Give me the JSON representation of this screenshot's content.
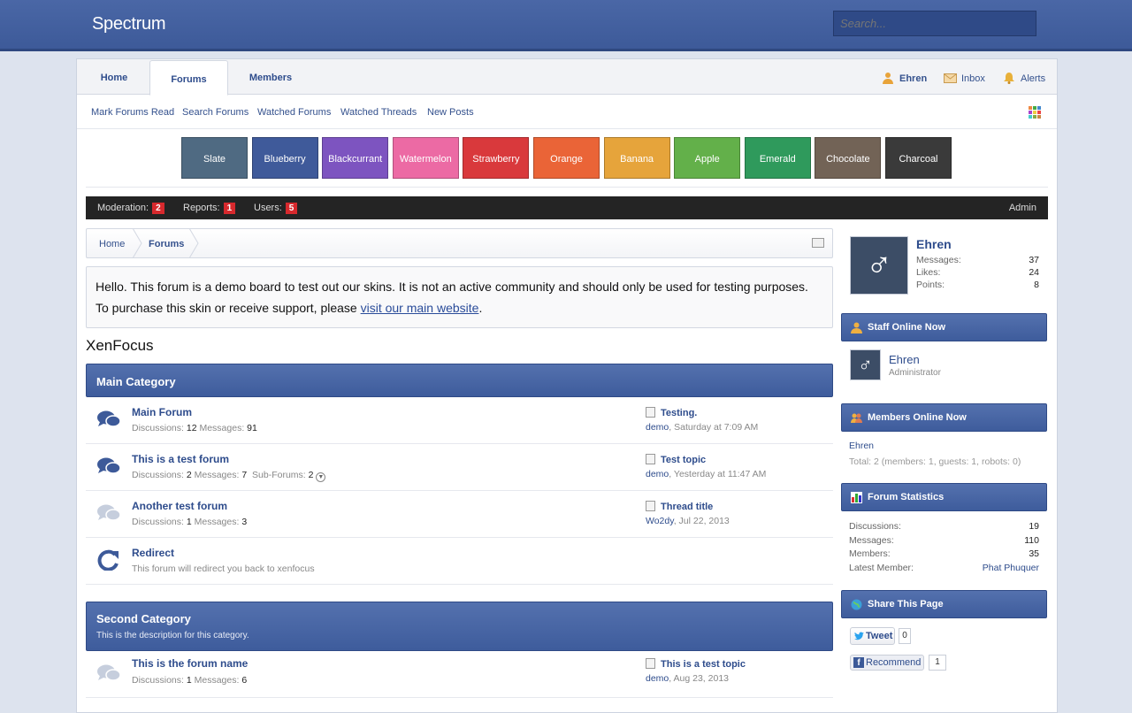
{
  "header": {
    "site_title": "Spectrum",
    "search_placeholder": "Search..."
  },
  "nav": {
    "tabs": [
      {
        "label": "Home"
      },
      {
        "label": "Forums",
        "active": true
      },
      {
        "label": "Members"
      }
    ],
    "user": {
      "name": "Ehren",
      "inbox": "Inbox",
      "alerts": "Alerts"
    }
  },
  "subnav": [
    "Mark Forums Read",
    "Search Forums",
    "Watched Forums",
    "Watched Threads",
    "New Posts"
  ],
  "styles": [
    {
      "label": "Slate",
      "color": "#4f6a82"
    },
    {
      "label": "Blueberry",
      "color": "#3f5a9a"
    },
    {
      "label": "Blackcurrant",
      "color": "#7d54c0"
    },
    {
      "label": "Watermelon",
      "color": "#ec6aa4"
    },
    {
      "label": "Strawberry",
      "color": "#d9393c"
    },
    {
      "label": "Orange",
      "color": "#ea6437"
    },
    {
      "label": "Banana",
      "color": "#e6a43b"
    },
    {
      "label": "Apple",
      "color": "#63b04a"
    },
    {
      "label": "Emerald",
      "color": "#2f9a5c"
    },
    {
      "label": "Chocolate",
      "color": "#726356"
    },
    {
      "label": "Charcoal",
      "color": "#3a3a3a"
    }
  ],
  "adminbar": {
    "moderation": "Moderation:",
    "moderation_count": "2",
    "reports": "Reports:",
    "reports_count": "1",
    "users": "Users:",
    "users_count": "5",
    "admin": "Admin"
  },
  "breadcrumb": [
    "Home",
    "Forums"
  ],
  "notice": {
    "line1": "Hello. This forum is a demo board to test out our skins. It is not an active community and should only be used for testing purposes.",
    "line2_prefix": "To purchase this skin or receive support, please ",
    "link": "visit our main website",
    "line2_suffix": "."
  },
  "section_title": "XenFocus",
  "categories": [
    {
      "title": "Main Category",
      "forums": [
        {
          "name": "Main Forum",
          "stats": {
            "discussions_label": "Discussions:",
            "discussions": "12",
            "messages_label": "Messages:",
            "messages": "91"
          },
          "last_thread": "Testing.",
          "last_user": "demo",
          "last_time": ", Saturday at 7:09 AM",
          "icon": "chat-bubbles-icon"
        },
        {
          "name": "This is a test forum",
          "stats": {
            "discussions_label": "Discussions:",
            "discussions": "2",
            "messages_label": "Messages:",
            "messages": "7",
            "subforums_label": "Sub-Forums:",
            "subforums": "2"
          },
          "last_thread": "Test topic",
          "last_user": "demo",
          "last_time": ", Yesterday at 11:47 AM",
          "icon": "chat-bubbles-icon"
        },
        {
          "name": "Another test forum",
          "stats": {
            "discussions_label": "Discussions:",
            "discussions": "1",
            "messages_label": "Messages:",
            "messages": "3"
          },
          "last_thread": "Thread title",
          "last_user": "Wo2dy",
          "last_time": ", Jul 22, 2013",
          "icon": "chat-bubbles-read-icon"
        },
        {
          "name": "Redirect",
          "description": "This forum will redirect you back to xenfocus",
          "icon": "redirect-icon"
        }
      ]
    },
    {
      "title": "Second Category",
      "description": "This is the description for this category.",
      "forums": [
        {
          "name": "This is the forum name",
          "stats": {
            "discussions_label": "Discussions:",
            "discussions": "1",
            "messages_label": "Messages:",
            "messages": "6"
          },
          "last_thread": "This is a test topic",
          "last_user": "demo",
          "last_time": ", Aug 23, 2013",
          "icon": "chat-bubbles-read-icon"
        }
      ]
    }
  ],
  "sidebar": {
    "profile": {
      "name": "Ehren",
      "messages_label": "Messages:",
      "messages": "37",
      "likes_label": "Likes:",
      "likes": "24",
      "points_label": "Points:",
      "points": "8"
    },
    "staff_online": {
      "title": "Staff Online Now",
      "name": "Ehren",
      "role": "Administrator"
    },
    "members_online": {
      "title": "Members Online Now",
      "member": "Ehren",
      "total": "Total: 2 (members: 1, guests: 1, robots: 0)"
    },
    "forum_stats": {
      "title": "Forum Statistics",
      "rows": [
        {
          "label": "Discussions:",
          "value": "19"
        },
        {
          "label": "Messages:",
          "value": "110"
        },
        {
          "label": "Members:",
          "value": "35"
        },
        {
          "label": "Latest Member:",
          "value": "Phat Phuquer"
        }
      ]
    },
    "share": {
      "title": "Share This Page",
      "tweet": "Tweet",
      "tweet_count": "0",
      "recommend": "Recommend",
      "recommend_count": "1"
    }
  }
}
